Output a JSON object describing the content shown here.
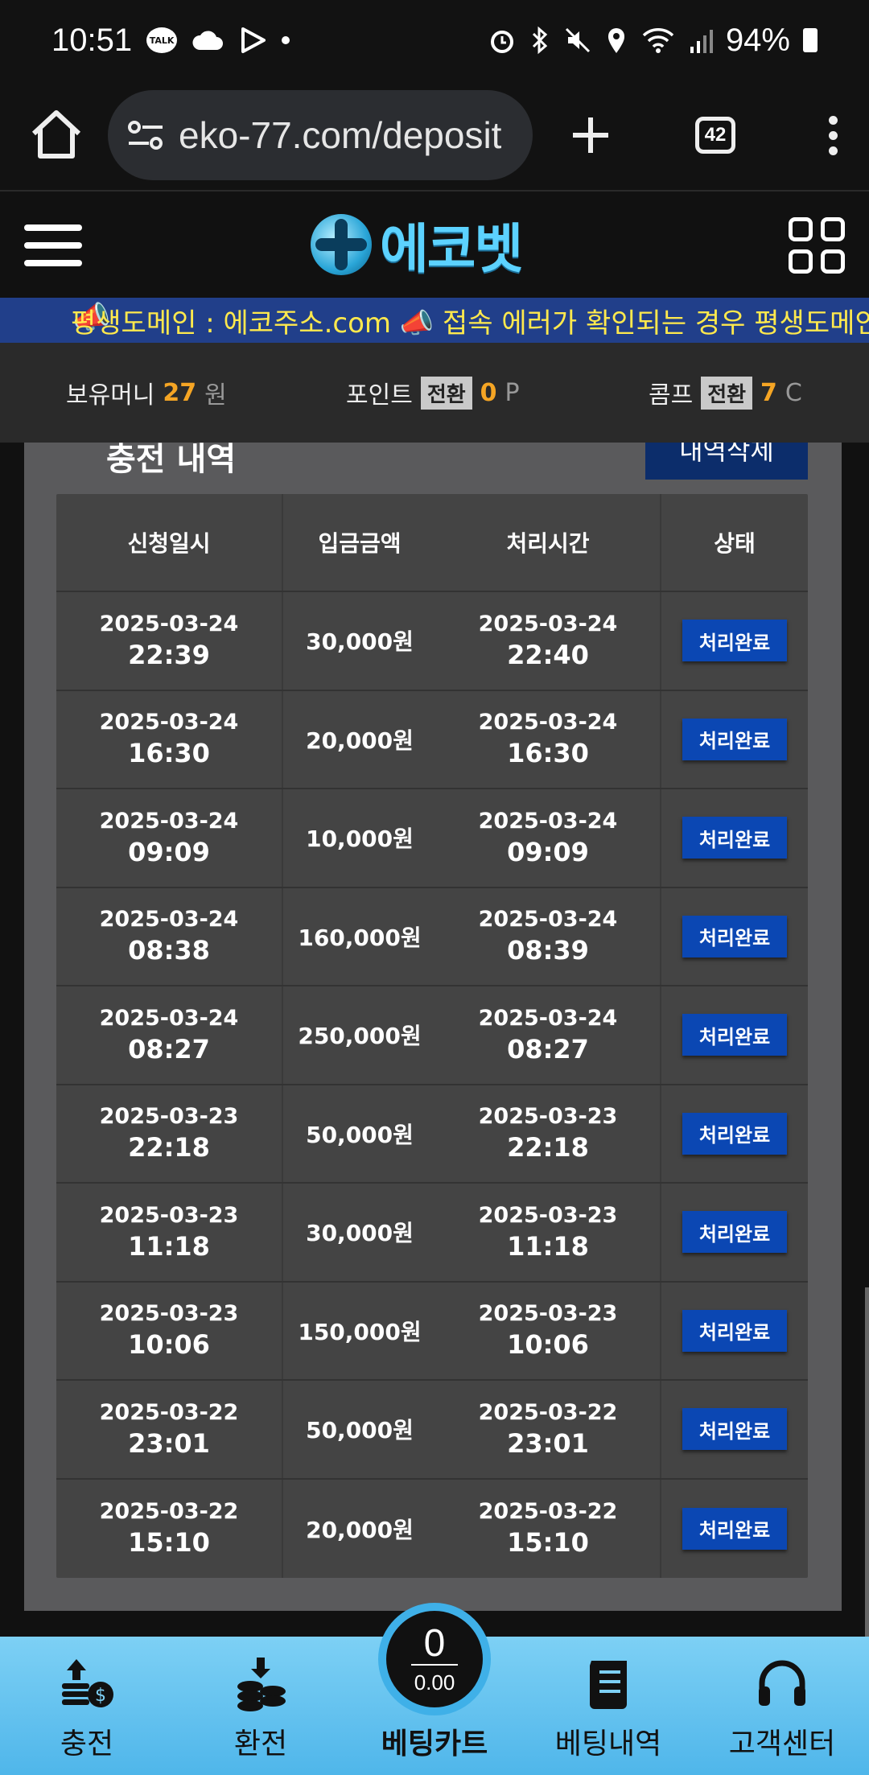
{
  "status_bar": {
    "time": "10:51",
    "talk": "TALK",
    "battery": "94%"
  },
  "browser": {
    "url": "eko-77.com/deposit",
    "tab_count": "42"
  },
  "site": {
    "logo_text": "에코벳"
  },
  "marquee": {
    "text": "평생도메인 : 에코주소.com 📣 접속 에러가 확인되는 경우 평생도메인"
  },
  "money": {
    "balance_label": "보유머니",
    "balance_value": "27",
    "balance_unit": "원",
    "point_label": "포인트",
    "point_convert": "전환",
    "point_value": "0",
    "point_unit": "P",
    "comp_label": "콤프",
    "comp_convert": "전환",
    "comp_value": "7",
    "comp_unit": "C"
  },
  "panel": {
    "title": "충전 내역",
    "delete_label": "내역삭제"
  },
  "table": {
    "headers": [
      "신청일시",
      "입금금액",
      "처리시간",
      "상태"
    ],
    "rows": [
      {
        "req_date": "2025-03-24",
        "req_time": "22:39",
        "amount": "30,000원",
        "proc_date": "2025-03-24",
        "proc_time": "22:40",
        "status": "처리완료"
      },
      {
        "req_date": "2025-03-24",
        "req_time": "16:30",
        "amount": "20,000원",
        "proc_date": "2025-03-24",
        "proc_time": "16:30",
        "status": "처리완료"
      },
      {
        "req_date": "2025-03-24",
        "req_time": "09:09",
        "amount": "10,000원",
        "proc_date": "2025-03-24",
        "proc_time": "09:09",
        "status": "처리완료"
      },
      {
        "req_date": "2025-03-24",
        "req_time": "08:38",
        "amount": "160,000원",
        "proc_date": "2025-03-24",
        "proc_time": "08:39",
        "status": "처리완료"
      },
      {
        "req_date": "2025-03-24",
        "req_time": "08:27",
        "amount": "250,000원",
        "proc_date": "2025-03-24",
        "proc_time": "08:27",
        "status": "처리완료"
      },
      {
        "req_date": "2025-03-23",
        "req_time": "22:18",
        "amount": "50,000원",
        "proc_date": "2025-03-23",
        "proc_time": "22:18",
        "status": "처리완료"
      },
      {
        "req_date": "2025-03-23",
        "req_time": "11:18",
        "amount": "30,000원",
        "proc_date": "2025-03-23",
        "proc_time": "11:18",
        "status": "처리완료"
      },
      {
        "req_date": "2025-03-23",
        "req_time": "10:06",
        "amount": "150,000원",
        "proc_date": "2025-03-23",
        "proc_time": "10:06",
        "status": "처리완료"
      },
      {
        "req_date": "2025-03-22",
        "req_time": "23:01",
        "amount": "50,000원",
        "proc_date": "2025-03-22",
        "proc_time": "23:01",
        "status": "처리완료"
      },
      {
        "req_date": "2025-03-22",
        "req_time": "15:10",
        "amount": "20,000원",
        "proc_date": "2025-03-22",
        "proc_time": "15:10",
        "status": "처리완료"
      }
    ]
  },
  "bottom_nav": {
    "deposit": "충전",
    "withdraw": "환전",
    "cart": "베팅카트",
    "cart_count": "0",
    "cart_amount": "0.00",
    "history": "베팅내역",
    "support": "고객센터"
  },
  "colors": {
    "accent_blue": "#0b47b3",
    "marquee_bg": "#213f8a",
    "marquee_text": "#ffe94d",
    "money_value": "#f5a524",
    "nav_bg": "#4fb6ea"
  },
  "icons": [
    "home-icon",
    "site-settings-icon",
    "plus-icon",
    "kebab-menu-icon",
    "hamburger-icon",
    "grid-menu-icon",
    "megaphone-icon",
    "deposit-icon",
    "withdraw-icon",
    "betting-history-icon",
    "headset-icon"
  ]
}
